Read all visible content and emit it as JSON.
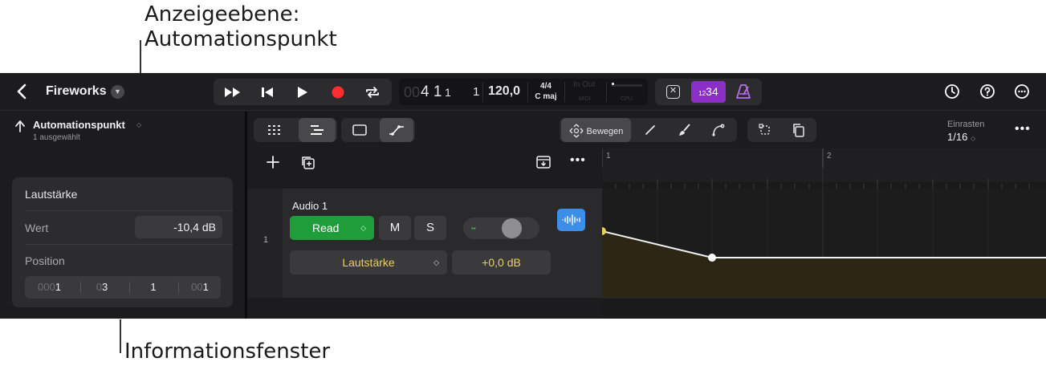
{
  "callouts": {
    "top_line1": "Anzeigeebene:",
    "top_line2": "Automationspunkt",
    "bottom": "Informationsfenster"
  },
  "topbar": {
    "project_name": "Fireworks",
    "lcd": {
      "position_dim": "00",
      "position": "4 1",
      "position_small": "1",
      "beat": "1",
      "tempo": "120,0",
      "time_signature": "4/4",
      "key": "C maj",
      "in_out": "In  Out",
      "midi_label": "MIDI",
      "cpu_label": "CPU"
    },
    "count_in": {
      "main": "34",
      "prefix": "12"
    }
  },
  "inspector": {
    "title": "Automationspunkt",
    "subtitle": "1 ausgewählt",
    "panel_title": "Lautstärke",
    "value_label": "Wert",
    "value": "-10,4 dB",
    "position_label": "Position",
    "position": {
      "bar_dim": "000",
      "bar": "1",
      "beat_dim": "0",
      "beat": "3",
      "division": "1",
      "tick_dim": "00",
      "tick": "1"
    }
  },
  "tracks_toolbar": {
    "move_label": "Bewegen",
    "snap_label": "Einrasten",
    "snap_value": "1/16"
  },
  "track": {
    "number": "1",
    "name": "Audio 1",
    "automation_mode": "Read",
    "mute_label": "M",
    "solo_label": "S",
    "parameter": "Lautstärke",
    "parameter_value": "+0,0 dB"
  },
  "ruler": {
    "bar1": "1",
    "bar2": "2"
  },
  "colors": {
    "read_green": "#1f9d3a",
    "count_in_purple": "#8b2fc7",
    "automation_yellow": "#e8d060",
    "region_fill": "#2b2714"
  }
}
